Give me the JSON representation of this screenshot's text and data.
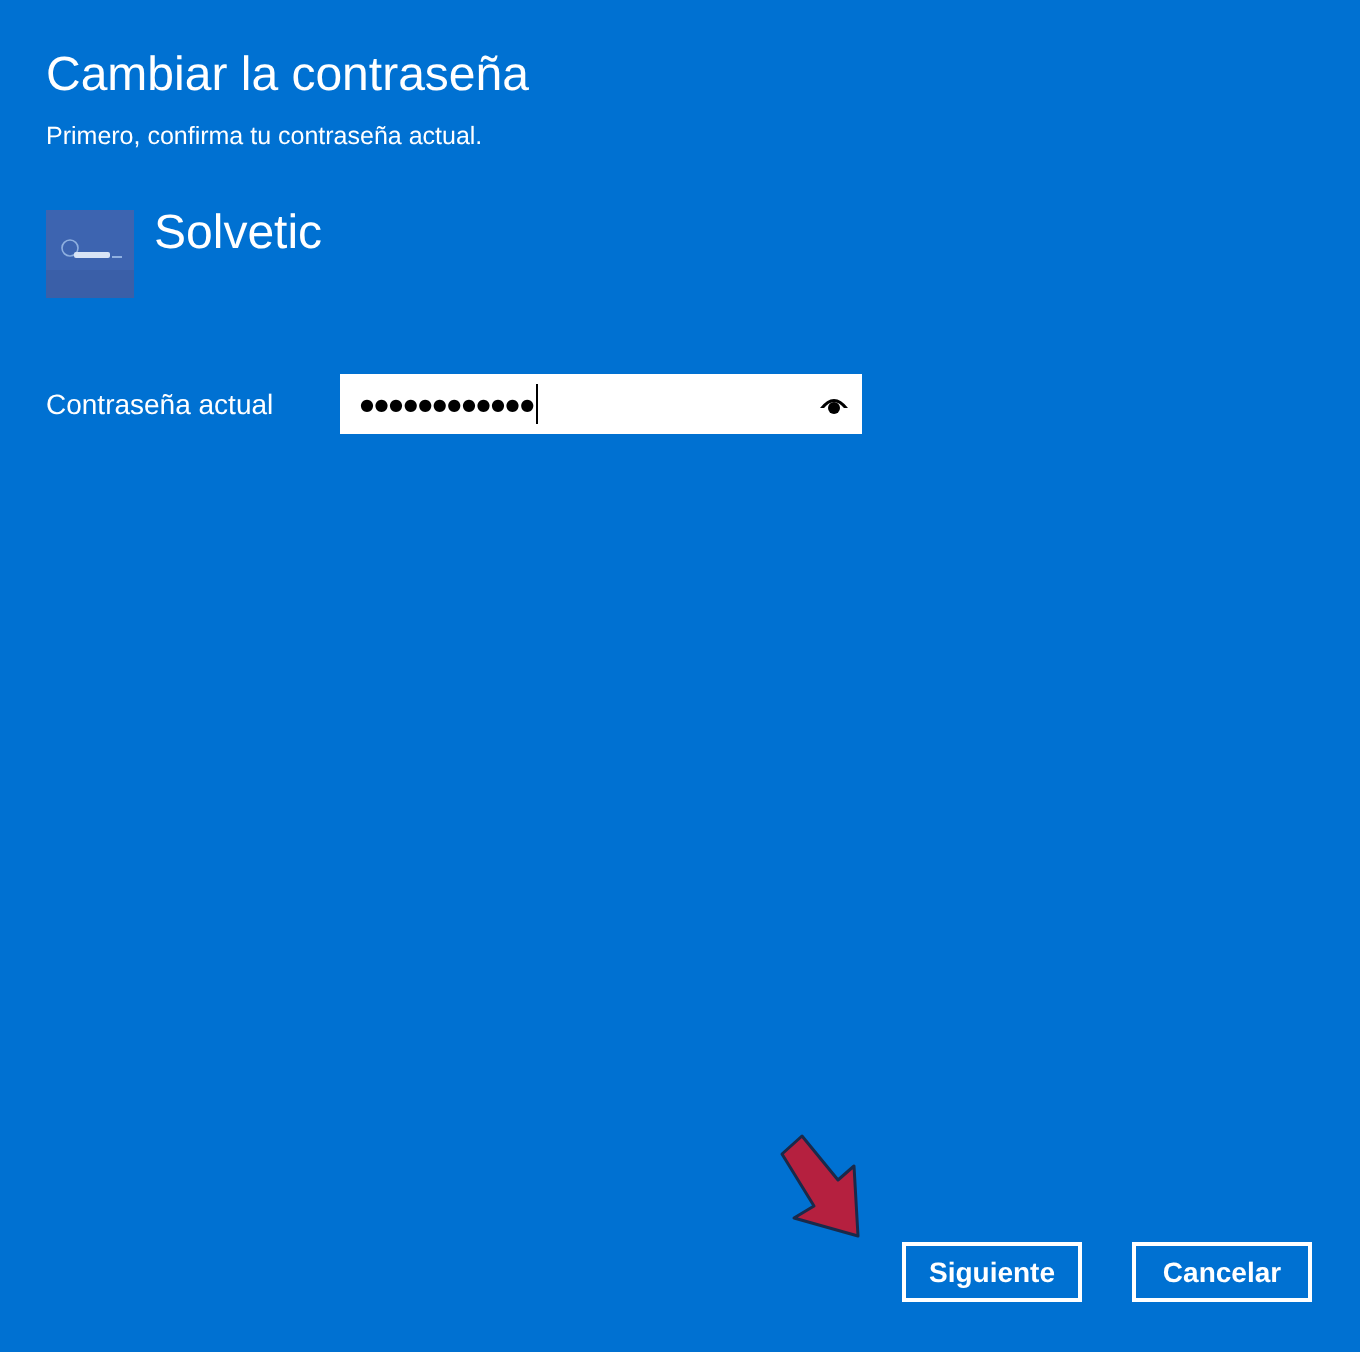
{
  "title": "Cambiar la contraseña",
  "subtitle": "Primero, confirma tu contraseña actual.",
  "account": {
    "name": "Solvetic"
  },
  "password_field": {
    "label": "Contraseña actual",
    "value": "●●●●●●●●●●●●"
  },
  "buttons": [
    "Siguiente",
    "Cancelar"
  ]
}
